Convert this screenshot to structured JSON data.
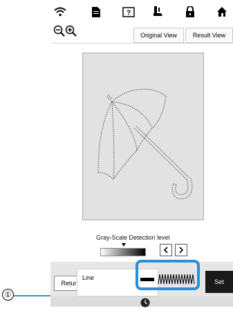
{
  "colors": {
    "highlight": "#2a8fd6",
    "set_button": "#1a1a1a"
  },
  "callout": {
    "number": "①"
  },
  "top_icons": [
    "wifi-icon",
    "document-icon",
    "help-icon",
    "presser-foot-icon",
    "lock-icon",
    "home-icon"
  ],
  "toolbar": {
    "zoom_out_icon": "zoom-out-icon",
    "zoom_in_icon": "zoom-in-icon",
    "original_view_label": "Original View",
    "result_view_label": "Result View"
  },
  "canvas": {
    "content": "umbrella-line-drawing"
  },
  "gray_scale": {
    "label": "Gray-Scale Detection level",
    "prev_icon": "chevron-left-icon",
    "next_icon": "chevron-right-icon"
  },
  "bottom": {
    "return_label": "Return",
    "line_label": "Line",
    "set_label": "Set"
  },
  "status": {
    "icon": "clock-icon"
  }
}
